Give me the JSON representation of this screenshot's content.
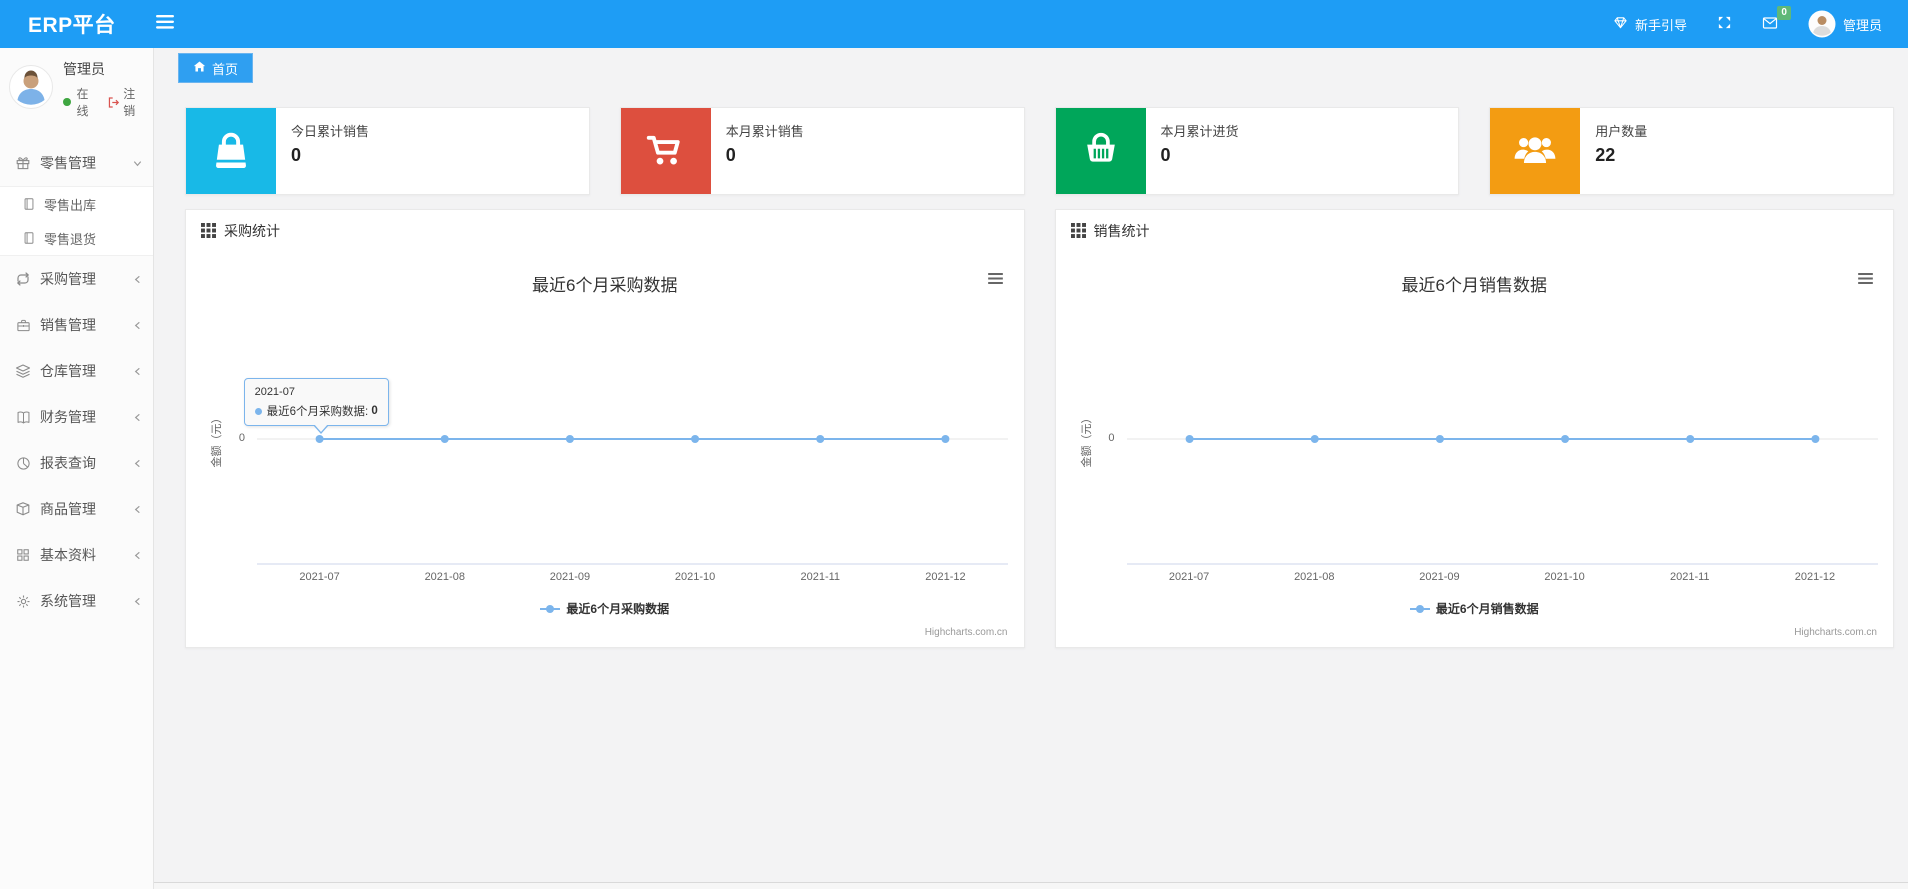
{
  "navbar": {
    "brand": "ERP平台",
    "guide_label": "新手引导",
    "mail_badge": "0",
    "username": "管理员"
  },
  "sidebar": {
    "user": {
      "name": "管理员",
      "status_label": "在线",
      "logout_label": "注销"
    },
    "menu": [
      {
        "id": "retail",
        "label": "零售管理",
        "icon": "gift",
        "expanded": true,
        "children": [
          {
            "id": "retail-out",
            "label": "零售出库",
            "icon": "doc"
          },
          {
            "id": "retail-return",
            "label": "零售退货",
            "icon": "doc"
          }
        ]
      },
      {
        "id": "purchase",
        "label": "采购管理",
        "icon": "repeat",
        "expanded": false
      },
      {
        "id": "sales",
        "label": "销售管理",
        "icon": "briefcase",
        "expanded": false
      },
      {
        "id": "warehouse",
        "label": "仓库管理",
        "icon": "layers",
        "expanded": false
      },
      {
        "id": "finance",
        "label": "财务管理",
        "icon": "book",
        "expanded": false
      },
      {
        "id": "report",
        "label": "报表查询",
        "icon": "pie",
        "expanded": false
      },
      {
        "id": "goods",
        "label": "商品管理",
        "icon": "box",
        "expanded": false
      },
      {
        "id": "basic",
        "label": "基本资料",
        "icon": "grid",
        "expanded": false
      },
      {
        "id": "system",
        "label": "系统管理",
        "icon": "gear",
        "expanded": false
      }
    ]
  },
  "tab": {
    "home_label": "首页"
  },
  "stats": [
    {
      "label": "今日累计销售",
      "value": "0",
      "color": "#18b9e7",
      "icon": "bag"
    },
    {
      "label": "本月累计销售",
      "value": "0",
      "color": "#dd4f3e",
      "icon": "cart"
    },
    {
      "label": "本月累计进货",
      "value": "0",
      "color": "#00a65a",
      "icon": "basket"
    },
    {
      "label": "用户数量",
      "value": "22",
      "color": "#f39c12",
      "icon": "users"
    }
  ],
  "chart_data": [
    {
      "type": "line",
      "panel_title": "采购统计",
      "title": "最近6个月采购数据",
      "categories": [
        "2021-07",
        "2021-08",
        "2021-09",
        "2021-10",
        "2021-11",
        "2021-12"
      ],
      "series": [
        {
          "name": "最近6个月采购数据",
          "values": [
            0,
            0,
            0,
            0,
            0,
            0
          ],
          "color": "#7cb5ec"
        }
      ],
      "ylabel": "金额（元）",
      "yticks": [
        "0"
      ],
      "ylim": [
        -1,
        1
      ],
      "grid": true,
      "legend_position": "bottom",
      "tooltip": {
        "category": "2021-07",
        "series": "最近6个月采购数据",
        "value": "0"
      },
      "credit": "Highcharts.com.cn"
    },
    {
      "type": "line",
      "panel_title": "销售统计",
      "title": "最近6个月销售数据",
      "categories": [
        "2021-07",
        "2021-08",
        "2021-09",
        "2021-10",
        "2021-11",
        "2021-12"
      ],
      "series": [
        {
          "name": "最近6个月销售数据",
          "values": [
            0,
            0,
            0,
            0,
            0,
            0
          ],
          "color": "#7cb5ec"
        }
      ],
      "ylabel": "金额（元）",
      "yticks": [
        "0"
      ],
      "ylim": [
        -1,
        1
      ],
      "grid": true,
      "legend_position": "bottom",
      "tooltip": null,
      "credit": "Highcharts.com.cn"
    }
  ]
}
